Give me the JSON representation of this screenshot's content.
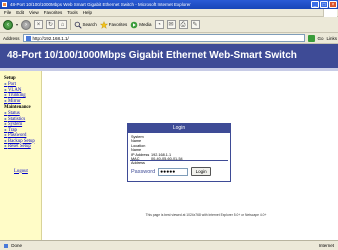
{
  "window": {
    "title": "48-Port 10/100/1000Mbps Web Smart Gigabit Ethernet Switch - Microsoft Internet Explorer"
  },
  "menu": [
    "File",
    "Edit",
    "View",
    "Favorites",
    "Tools",
    "Help"
  ],
  "toolbar": {
    "back_label": "Back",
    "search_label": "Search",
    "favorites_label": "Favorites",
    "media_label": "Media"
  },
  "address": {
    "label": "Address",
    "url": "http://192.168.1.1/",
    "go_label": "Go",
    "links_label": "Links"
  },
  "banner": {
    "title": "48-Port 10/100/1000Mbps Gigabit Ethernet Web-Smart Switch"
  },
  "sidebar": {
    "setup_heading": "Setup",
    "setup_items": [
      "Port",
      "VLAN",
      "Trunking",
      "Mirror"
    ],
    "maintenance_heading": "Maintenance",
    "maintenance_items": [
      "Status",
      "Statistics",
      "System",
      "Trap",
      "Password",
      "Backup Setup",
      "Reset Setup"
    ],
    "logout_label": "Logout"
  },
  "login": {
    "title": "Login",
    "info": [
      {
        "label": "System Name",
        "value": ""
      },
      {
        "label": "Location Name",
        "value": ""
      },
      {
        "label": "IP Address",
        "value": "192.168.1.1"
      },
      {
        "label": "MAC Address",
        "value": "00-40-05-60-01-54"
      }
    ],
    "password_label": "Password",
    "password_value": "●●●●●",
    "button_label": "Login"
  },
  "footer": {
    "note": "This page is best viewed at 1024x768 with Internet Explorer 5.0+ or Netscape 4.0+"
  },
  "status": {
    "left": "Done",
    "right": "Internet"
  },
  "colors": {
    "banner": "#3e4b96",
    "sidebar": "#fffcc7",
    "link": "#0000cc"
  }
}
